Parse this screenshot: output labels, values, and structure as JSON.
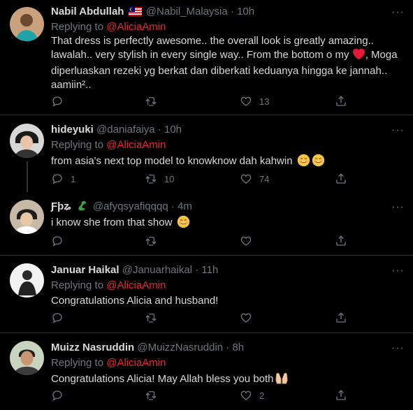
{
  "tweets": [
    {
      "name": "Nabil Abdullah",
      "handle": "@Nabil_Malaysia",
      "time": "10h",
      "replying_label": "Replying to",
      "mention": "@AliciaAmin",
      "text_1": "That dress is perfectly awesome.. the overall look is greatly amazing.. lawalah.. very stylish in every single way.. From the bottom o my",
      "text_2": ", Moga diperluaskan rezeki yg berkat dan diberkati keduanya hingga ke jannah.. aamiin²..",
      "reply_count": "",
      "retweet_count": "",
      "like_count": "13"
    },
    {
      "name": "hideyuki",
      "handle": "@daniafaiya",
      "time": "10h",
      "replying_label": "Replying to",
      "mention": "@AliciaAmin",
      "text": "from asia's next top model to knowknow dah kahwin",
      "reply_count": "1",
      "retweet_count": "10",
      "like_count": "74"
    },
    {
      "name": "Ƒþʑ",
      "handle": "@afyqsyafiqqqq",
      "time": "4m",
      "text": "i know she from that show",
      "reply_count": "",
      "retweet_count": "",
      "like_count": ""
    },
    {
      "name": "Januar Haikal",
      "handle": "@Januarhaikal",
      "time": "11h",
      "replying_label": "Replying to",
      "mention": "@AliciaAmin",
      "text": "Congratulations Alicia and husband!",
      "reply_count": "",
      "retweet_count": "",
      "like_count": ""
    },
    {
      "name": "Muizz Nasruddin",
      "handle": "@MuizzNasruddin",
      "time": "8h",
      "replying_label": "Replying to",
      "mention": "@AliciaAmin",
      "text": "Congratulations Alicia! May Allah bless you both",
      "reply_count": "",
      "retweet_count": "",
      "like_count": "2"
    }
  ],
  "more_label": "···",
  "dot": "·",
  "colors": {
    "background": "#000000",
    "text": "#d9d9d9",
    "muted": "#6e767d",
    "mention": "#f4212e",
    "divider": "#2f3336",
    "heart": "#f91880"
  },
  "icons": [
    "reply-icon",
    "retweet-icon",
    "like-icon",
    "share-icon",
    "malaysia-flag-icon",
    "heart-emoji-icon",
    "smile-emoji-icon",
    "praying-hands-emoji-icon",
    "dragon-emoji-icon",
    "more-icon"
  ]
}
